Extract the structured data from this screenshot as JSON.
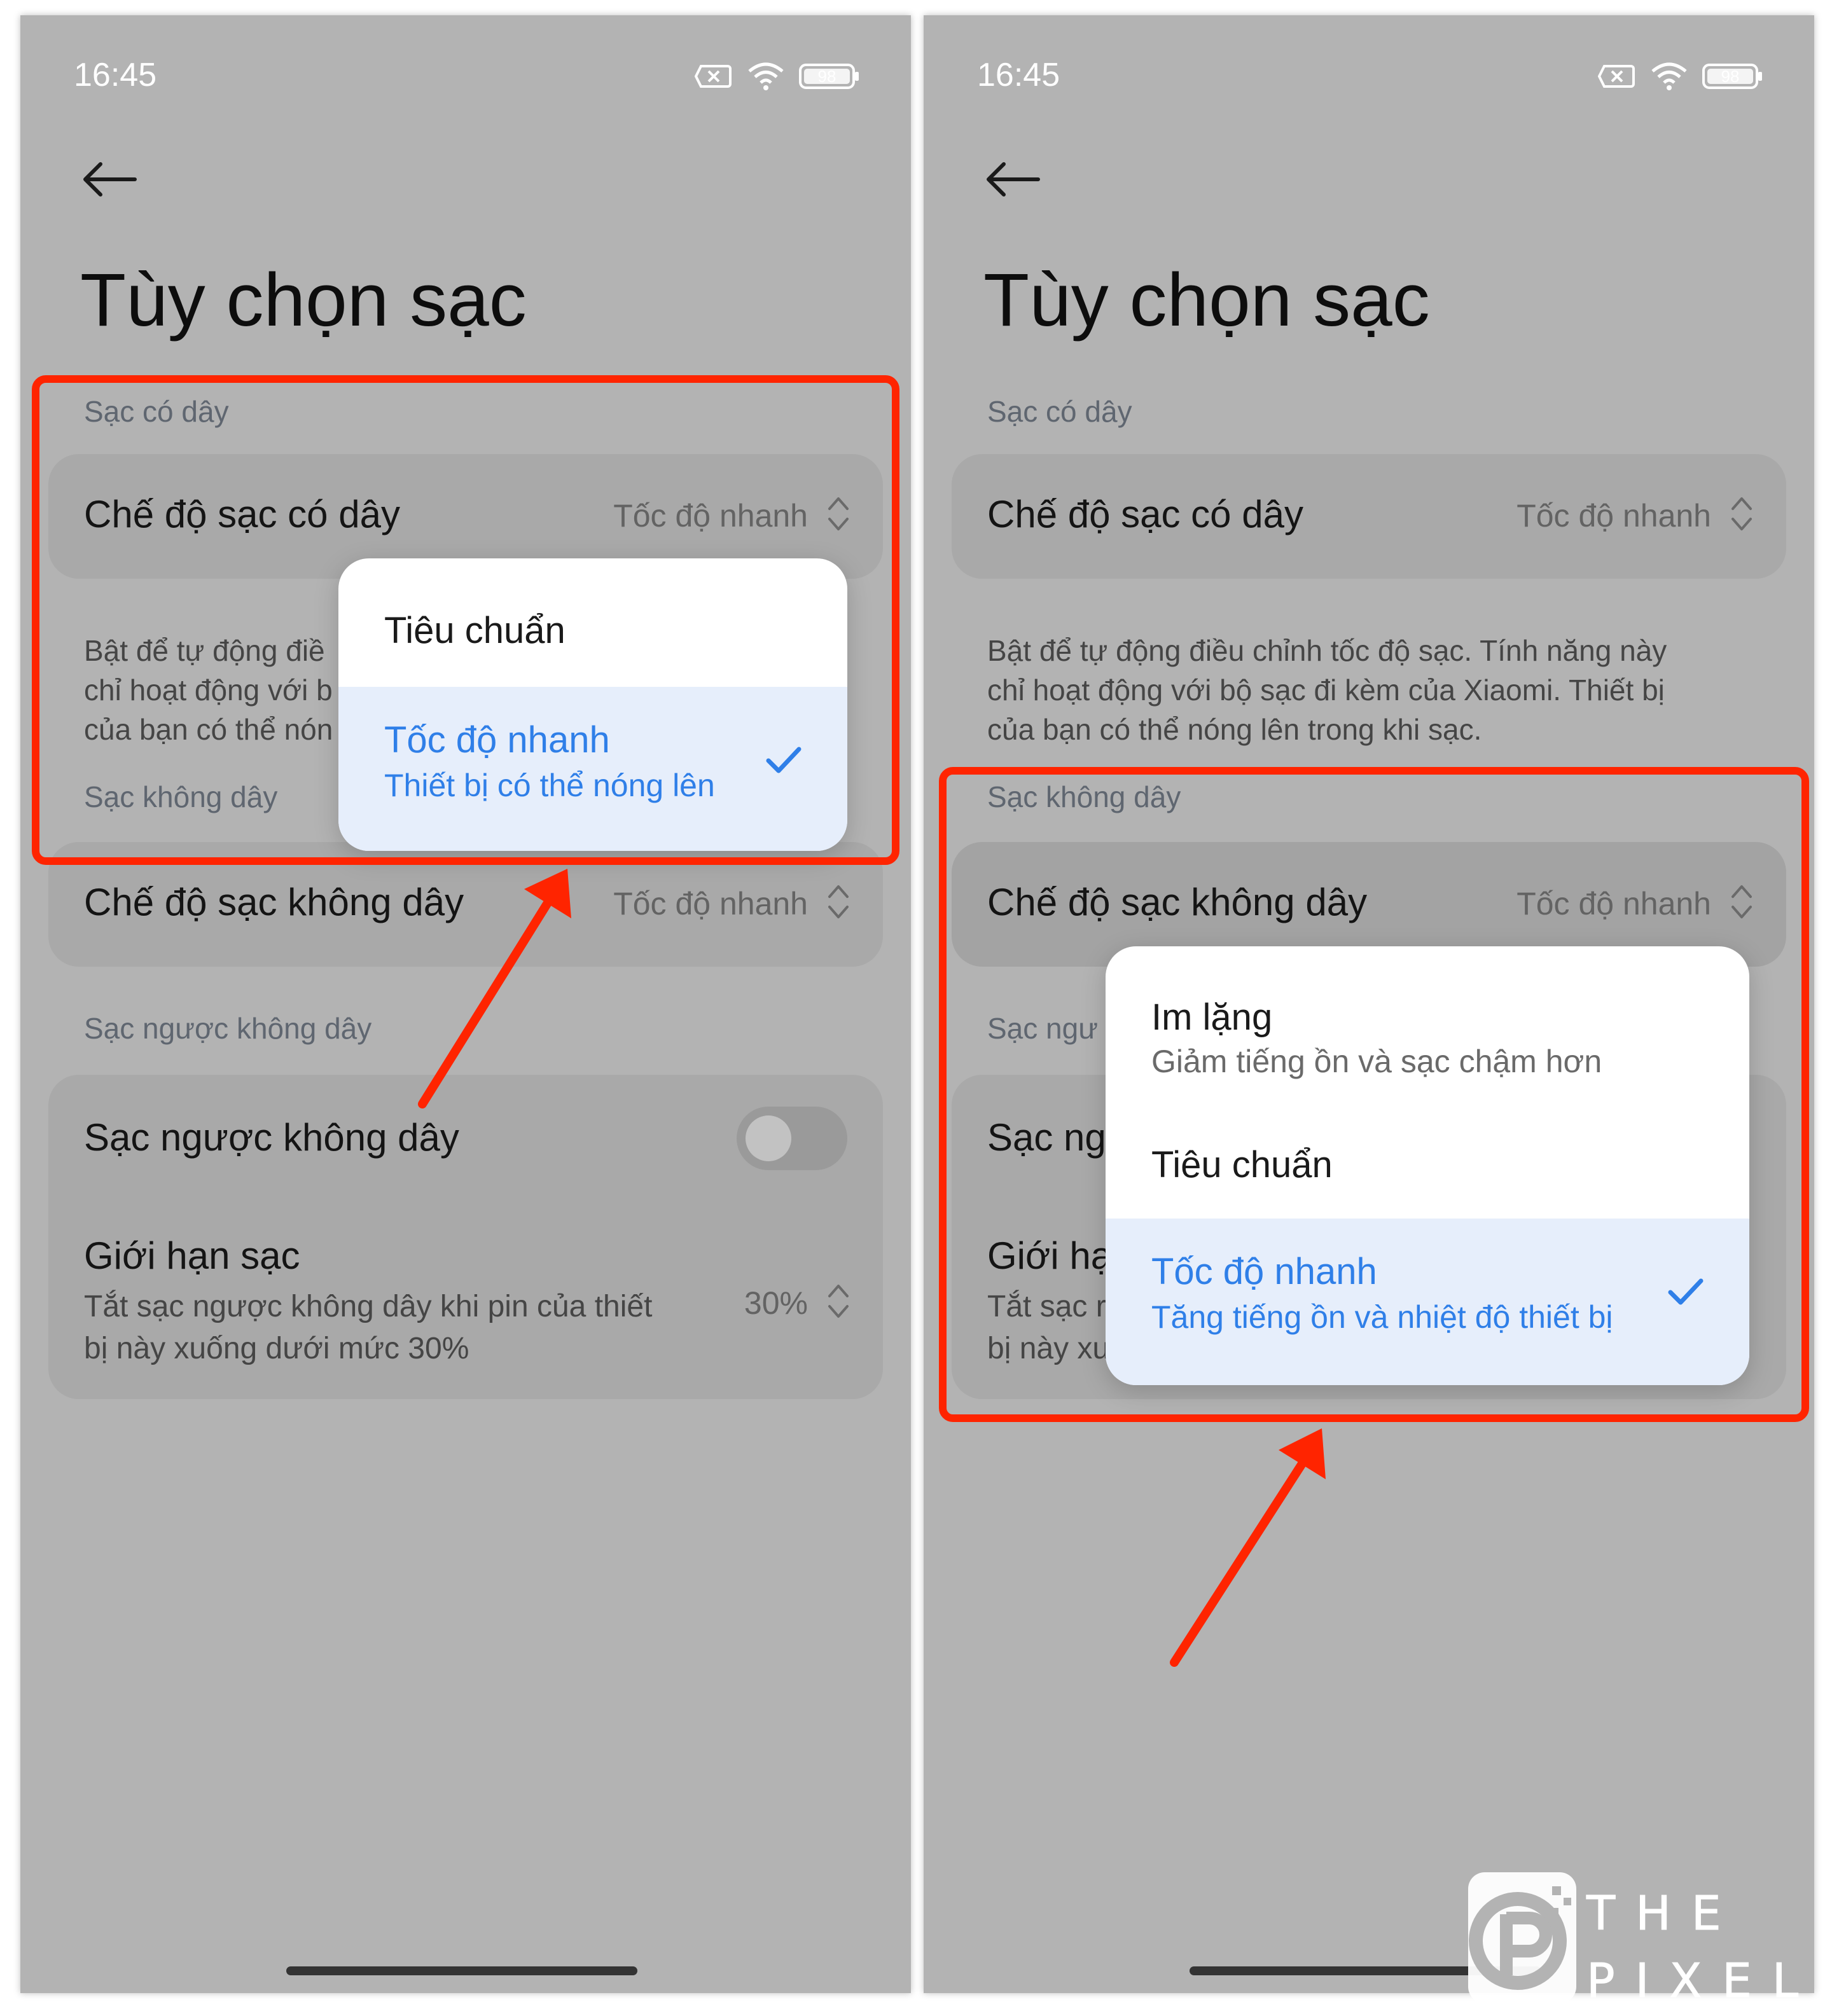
{
  "status_bar": {
    "time": "16:45",
    "battery": "98"
  },
  "page": {
    "title": "Tùy chọn sạc"
  },
  "sections": {
    "wired": {
      "label": "Sạc có dây",
      "row_title": "Chế độ sạc có dây",
      "row_value": "Tốc độ nhanh",
      "description_lines": [
        "Bật để tự động điều chỉnh tốc độ sạc. Tính năng này",
        "chỉ hoạt động với bộ sạc đi kèm của Xiaomi. Thiết bị",
        "của bạn có thể nóng lên trong khi sạc."
      ],
      "description_lines_cut": [
        "Bật để tự động điề",
        "chỉ hoạt động với b",
        "của bạn có thể nón"
      ]
    },
    "wireless": {
      "label": "Sạc không dây",
      "row_title": "Chế độ sạc không dây",
      "row_value": "Tốc độ nhanh"
    },
    "reverse": {
      "label": "Sạc ngược không dây",
      "label_cut": "Sạc ngư",
      "toggle_title": "Sạc ngược không dây",
      "toggle_title_cut": "Sạc ng",
      "toggle_on": false,
      "limit_title": "Giới hạn sạc",
      "limit_title_cut": "Giới hạ",
      "limit_desc_lines": [
        "Tắt sạc ngược không dây khi pin của thiết",
        "bị này xuống dưới mức 30%"
      ],
      "limit_desc_lines_cut": [
        "Tắt sạc r",
        "bị này xu"
      ],
      "limit_value": "30%"
    }
  },
  "popup_wired": {
    "options": [
      {
        "title": "Tiêu chuẩn",
        "subtitle": "",
        "selected": false
      },
      {
        "title": "Tốc độ nhanh",
        "subtitle": "Thiết bị có thể nóng lên",
        "selected": true
      }
    ]
  },
  "popup_wireless": {
    "options": [
      {
        "title": "Im lặng",
        "subtitle": "Giảm tiếng ồn và sạc chậm hơn",
        "selected": false
      },
      {
        "title": "Tiêu chuẩn",
        "subtitle": "",
        "selected": false
      },
      {
        "title": "Tốc độ nhanh",
        "subtitle": "Tăng tiếng ồn và nhiệt độ thiết bị",
        "selected": true
      }
    ]
  },
  "watermark": {
    "line1": "THE",
    "line2": "PIXEL"
  },
  "colors": {
    "accent": "#2f7fe8",
    "annotation": "#ff2400",
    "screen_dim": "#b3b3b3"
  }
}
